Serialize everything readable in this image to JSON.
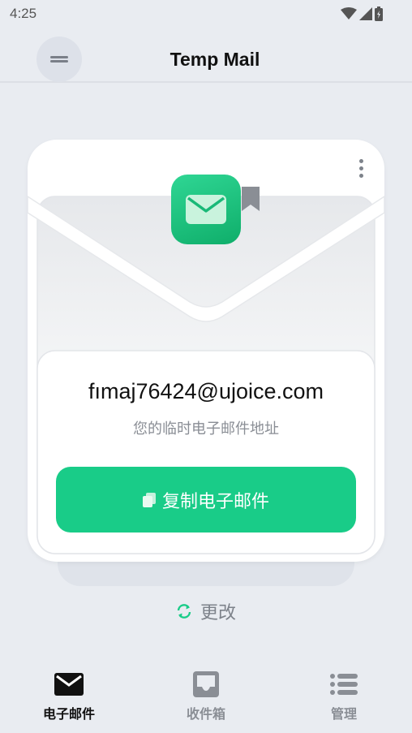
{
  "status_bar": {
    "time": "4:25"
  },
  "app_bar": {
    "title": "Temp Mail"
  },
  "card": {
    "email": "fımaj76424@ujoice.com",
    "caption": "您的临时电子邮件地址",
    "copy_label": "复制电子邮件"
  },
  "change_label": "更改",
  "bottom_nav": {
    "items": [
      {
        "label": "电子邮件",
        "icon": "mail-icon",
        "active": true
      },
      {
        "label": "收件箱",
        "icon": "inbox-icon",
        "active": false
      },
      {
        "label": "管理",
        "icon": "list-icon",
        "active": false
      }
    ]
  },
  "colors": {
    "accent": "#19cc88",
    "background": "#e9ecf1",
    "muted_text": "#8a8e95"
  }
}
